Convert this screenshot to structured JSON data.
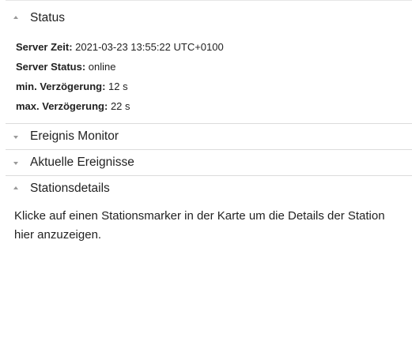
{
  "sections": {
    "status": {
      "title": "Status",
      "expanded": true,
      "rows": [
        {
          "label": "Server Zeit:",
          "value": "2021-03-23 13:55:22 UTC+0100"
        },
        {
          "label": "Server Status:",
          "value": "online"
        },
        {
          "label": "min. Verzögerung:",
          "value": "12 s"
        },
        {
          "label": "max. Verzögerung:",
          "value": "22 s"
        }
      ]
    },
    "event_monitor": {
      "title": "Ereignis Monitor",
      "expanded": false
    },
    "current_events": {
      "title": "Aktuelle Ereignisse",
      "expanded": false
    },
    "station_details": {
      "title": "Stationsdetails",
      "expanded": true,
      "text": "Klicke auf einen Stationsmarker in der Karte um die Details der Station hier anzuzeigen."
    }
  },
  "icons": {
    "expanded": "chevron-up-icon",
    "collapsed": "chevron-down-icon"
  }
}
